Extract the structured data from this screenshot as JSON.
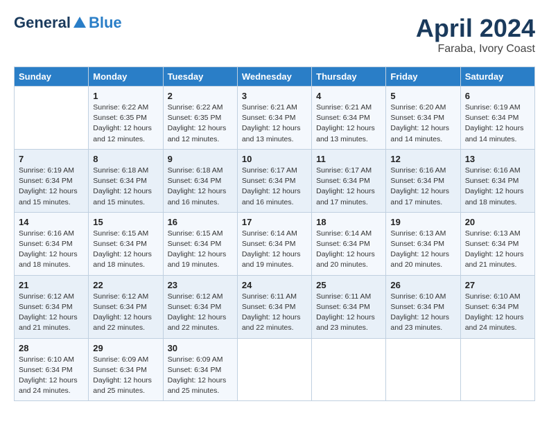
{
  "logo": {
    "general": "General",
    "blue": "Blue"
  },
  "title": "April 2024",
  "subtitle": "Faraba, Ivory Coast",
  "days": [
    "Sunday",
    "Monday",
    "Tuesday",
    "Wednesday",
    "Thursday",
    "Friday",
    "Saturday"
  ],
  "weeks": [
    [
      {
        "day": null,
        "info": null
      },
      {
        "day": "1",
        "info": "Sunrise: 6:22 AM\nSunset: 6:35 PM\nDaylight: 12 hours\nand 12 minutes."
      },
      {
        "day": "2",
        "info": "Sunrise: 6:22 AM\nSunset: 6:35 PM\nDaylight: 12 hours\nand 12 minutes."
      },
      {
        "day": "3",
        "info": "Sunrise: 6:21 AM\nSunset: 6:34 PM\nDaylight: 12 hours\nand 13 minutes."
      },
      {
        "day": "4",
        "info": "Sunrise: 6:21 AM\nSunset: 6:34 PM\nDaylight: 12 hours\nand 13 minutes."
      },
      {
        "day": "5",
        "info": "Sunrise: 6:20 AM\nSunset: 6:34 PM\nDaylight: 12 hours\nand 14 minutes."
      },
      {
        "day": "6",
        "info": "Sunrise: 6:19 AM\nSunset: 6:34 PM\nDaylight: 12 hours\nand 14 minutes."
      }
    ],
    [
      {
        "day": "7",
        "info": "Sunrise: 6:19 AM\nSunset: 6:34 PM\nDaylight: 12 hours\nand 15 minutes."
      },
      {
        "day": "8",
        "info": "Sunrise: 6:18 AM\nSunset: 6:34 PM\nDaylight: 12 hours\nand 15 minutes."
      },
      {
        "day": "9",
        "info": "Sunrise: 6:18 AM\nSunset: 6:34 PM\nDaylight: 12 hours\nand 16 minutes."
      },
      {
        "day": "10",
        "info": "Sunrise: 6:17 AM\nSunset: 6:34 PM\nDaylight: 12 hours\nand 16 minutes."
      },
      {
        "day": "11",
        "info": "Sunrise: 6:17 AM\nSunset: 6:34 PM\nDaylight: 12 hours\nand 17 minutes."
      },
      {
        "day": "12",
        "info": "Sunrise: 6:16 AM\nSunset: 6:34 PM\nDaylight: 12 hours\nand 17 minutes."
      },
      {
        "day": "13",
        "info": "Sunrise: 6:16 AM\nSunset: 6:34 PM\nDaylight: 12 hours\nand 18 minutes."
      }
    ],
    [
      {
        "day": "14",
        "info": "Sunrise: 6:16 AM\nSunset: 6:34 PM\nDaylight: 12 hours\nand 18 minutes."
      },
      {
        "day": "15",
        "info": "Sunrise: 6:15 AM\nSunset: 6:34 PM\nDaylight: 12 hours\nand 18 minutes."
      },
      {
        "day": "16",
        "info": "Sunrise: 6:15 AM\nSunset: 6:34 PM\nDaylight: 12 hours\nand 19 minutes."
      },
      {
        "day": "17",
        "info": "Sunrise: 6:14 AM\nSunset: 6:34 PM\nDaylight: 12 hours\nand 19 minutes."
      },
      {
        "day": "18",
        "info": "Sunrise: 6:14 AM\nSunset: 6:34 PM\nDaylight: 12 hours\nand 20 minutes."
      },
      {
        "day": "19",
        "info": "Sunrise: 6:13 AM\nSunset: 6:34 PM\nDaylight: 12 hours\nand 20 minutes."
      },
      {
        "day": "20",
        "info": "Sunrise: 6:13 AM\nSunset: 6:34 PM\nDaylight: 12 hours\nand 21 minutes."
      }
    ],
    [
      {
        "day": "21",
        "info": "Sunrise: 6:12 AM\nSunset: 6:34 PM\nDaylight: 12 hours\nand 21 minutes."
      },
      {
        "day": "22",
        "info": "Sunrise: 6:12 AM\nSunset: 6:34 PM\nDaylight: 12 hours\nand 22 minutes."
      },
      {
        "day": "23",
        "info": "Sunrise: 6:12 AM\nSunset: 6:34 PM\nDaylight: 12 hours\nand 22 minutes."
      },
      {
        "day": "24",
        "info": "Sunrise: 6:11 AM\nSunset: 6:34 PM\nDaylight: 12 hours\nand 22 minutes."
      },
      {
        "day": "25",
        "info": "Sunrise: 6:11 AM\nSunset: 6:34 PM\nDaylight: 12 hours\nand 23 minutes."
      },
      {
        "day": "26",
        "info": "Sunrise: 6:10 AM\nSunset: 6:34 PM\nDaylight: 12 hours\nand 23 minutes."
      },
      {
        "day": "27",
        "info": "Sunrise: 6:10 AM\nSunset: 6:34 PM\nDaylight: 12 hours\nand 24 minutes."
      }
    ],
    [
      {
        "day": "28",
        "info": "Sunrise: 6:10 AM\nSunset: 6:34 PM\nDaylight: 12 hours\nand 24 minutes."
      },
      {
        "day": "29",
        "info": "Sunrise: 6:09 AM\nSunset: 6:34 PM\nDaylight: 12 hours\nand 25 minutes."
      },
      {
        "day": "30",
        "info": "Sunrise: 6:09 AM\nSunset: 6:34 PM\nDaylight: 12 hours\nand 25 minutes."
      },
      {
        "day": null,
        "info": null
      },
      {
        "day": null,
        "info": null
      },
      {
        "day": null,
        "info": null
      },
      {
        "day": null,
        "info": null
      }
    ]
  ]
}
